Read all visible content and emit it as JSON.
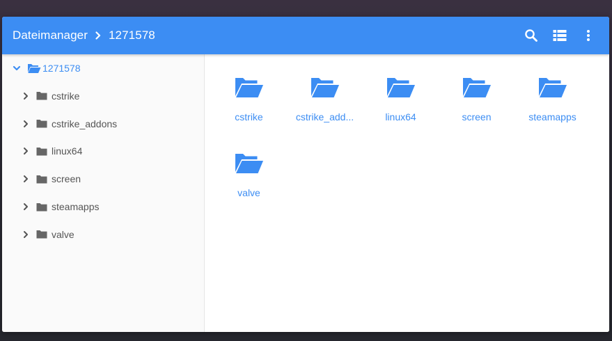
{
  "header": {
    "app_title": "Dateimanager",
    "current_folder": "1271578",
    "icons": [
      "search-icon",
      "list-view-icon",
      "more-vert-icon"
    ]
  },
  "colors": {
    "accent": "#3c8df3",
    "sidebar_bg": "#fafafa",
    "tree_text": "#555555"
  },
  "sidebar": {
    "root": {
      "label": "1271578",
      "icon": "folder-open-icon",
      "expanded": true
    },
    "items": [
      {
        "label": "cstrike",
        "icon": "folder-icon"
      },
      {
        "label": "cstrike_addons",
        "icon": "folder-icon"
      },
      {
        "label": "linux64",
        "icon": "folder-icon"
      },
      {
        "label": "screen",
        "icon": "folder-icon"
      },
      {
        "label": "steamapps",
        "icon": "folder-icon"
      },
      {
        "label": "valve",
        "icon": "folder-icon"
      }
    ]
  },
  "main": {
    "folders": [
      {
        "label": "cstrike"
      },
      {
        "label": "cstrike_add..."
      },
      {
        "label": "linux64"
      },
      {
        "label": "screen"
      },
      {
        "label": "steamapps"
      },
      {
        "label": "valve"
      }
    ]
  }
}
